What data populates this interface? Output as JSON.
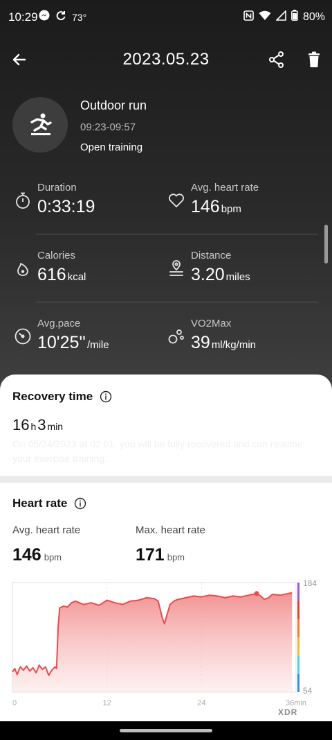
{
  "status_bar": {
    "time": "10:29",
    "temperature": "73°",
    "battery": "80%"
  },
  "header": {
    "title": "2023.05.23"
  },
  "activity": {
    "type": "Outdoor run",
    "time_range": "09:23-09:57",
    "mode": "Open training"
  },
  "stats": {
    "duration": {
      "label": "Duration",
      "value": "0:33:19",
      "unit": ""
    },
    "avg_hr": {
      "label": "Avg. heart rate",
      "value": "146",
      "unit": "bpm"
    },
    "calories": {
      "label": "Calories",
      "value": "616",
      "unit": "kcal"
    },
    "distance": {
      "label": "Distance",
      "value": "3.20",
      "unit": "miles"
    },
    "pace": {
      "label": "Avg.pace",
      "value": "10'25''",
      "unit": "/mile"
    },
    "vo2max": {
      "label": "VO2Max",
      "value": "39",
      "unit": "ml/kg/min"
    }
  },
  "recovery": {
    "title": "Recovery time",
    "hours": "16",
    "h_unit": "h",
    "minutes": "3",
    "m_unit": "min",
    "message": "On 05/24/2023 at 02:01, you will be fully recovered and can resume your exercise training."
  },
  "heart_rate": {
    "title": "Heart rate",
    "avg_label": "Avg. heart rate",
    "avg_value": "146",
    "avg_unit": "bpm",
    "max_label": "Max. heart rate",
    "max_value": "171",
    "max_unit": "bpm"
  },
  "watermark": "XDR",
  "chart_data": {
    "type": "area",
    "xlim": [
      0,
      36
    ],
    "ylim": [
      54,
      184
    ],
    "x_tick_labels": [
      "0",
      "12",
      "24",
      "36min"
    ],
    "y_tick_labels": [
      "184",
      "54"
    ],
    "x": [
      0,
      0.3,
      0.6,
      1,
      1.4,
      1.8,
      2.2,
      2.6,
      3,
      3.4,
      3.8,
      4.2,
      4.6,
      5,
      5.4,
      5.6,
      5.8,
      6,
      6.5,
      7,
      7.5,
      8,
      9,
      10,
      11,
      12,
      13,
      14,
      15,
      16,
      17,
      18,
      18.5,
      19,
      19.3,
      19.6,
      20,
      20.5,
      21,
      22,
      23,
      24,
      25,
      26,
      27,
      28,
      29,
      30,
      31,
      31.5,
      32,
      32.5,
      33,
      34,
      35,
      35.5
    ],
    "y": [
      78,
      82,
      75,
      84,
      80,
      85,
      79,
      83,
      77,
      86,
      81,
      84,
      74,
      80,
      84,
      82,
      132,
      154,
      156,
      155,
      160,
      162,
      158,
      160,
      157,
      163,
      160,
      158,
      162,
      163,
      166,
      165,
      162,
      143,
      135,
      145,
      158,
      162,
      164,
      166,
      168,
      167,
      169,
      168,
      166,
      168,
      167,
      169,
      171,
      168,
      164,
      166,
      170,
      169,
      171,
      172
    ],
    "highlight_point": {
      "x": 31,
      "y": 171
    },
    "line_color": "#e74c4c",
    "zone_colors": [
      "#3a8bd8",
      "#4ed0e0",
      "#f2b630",
      "#f07a2a",
      "#e23b3b",
      "#9b59d0"
    ]
  }
}
